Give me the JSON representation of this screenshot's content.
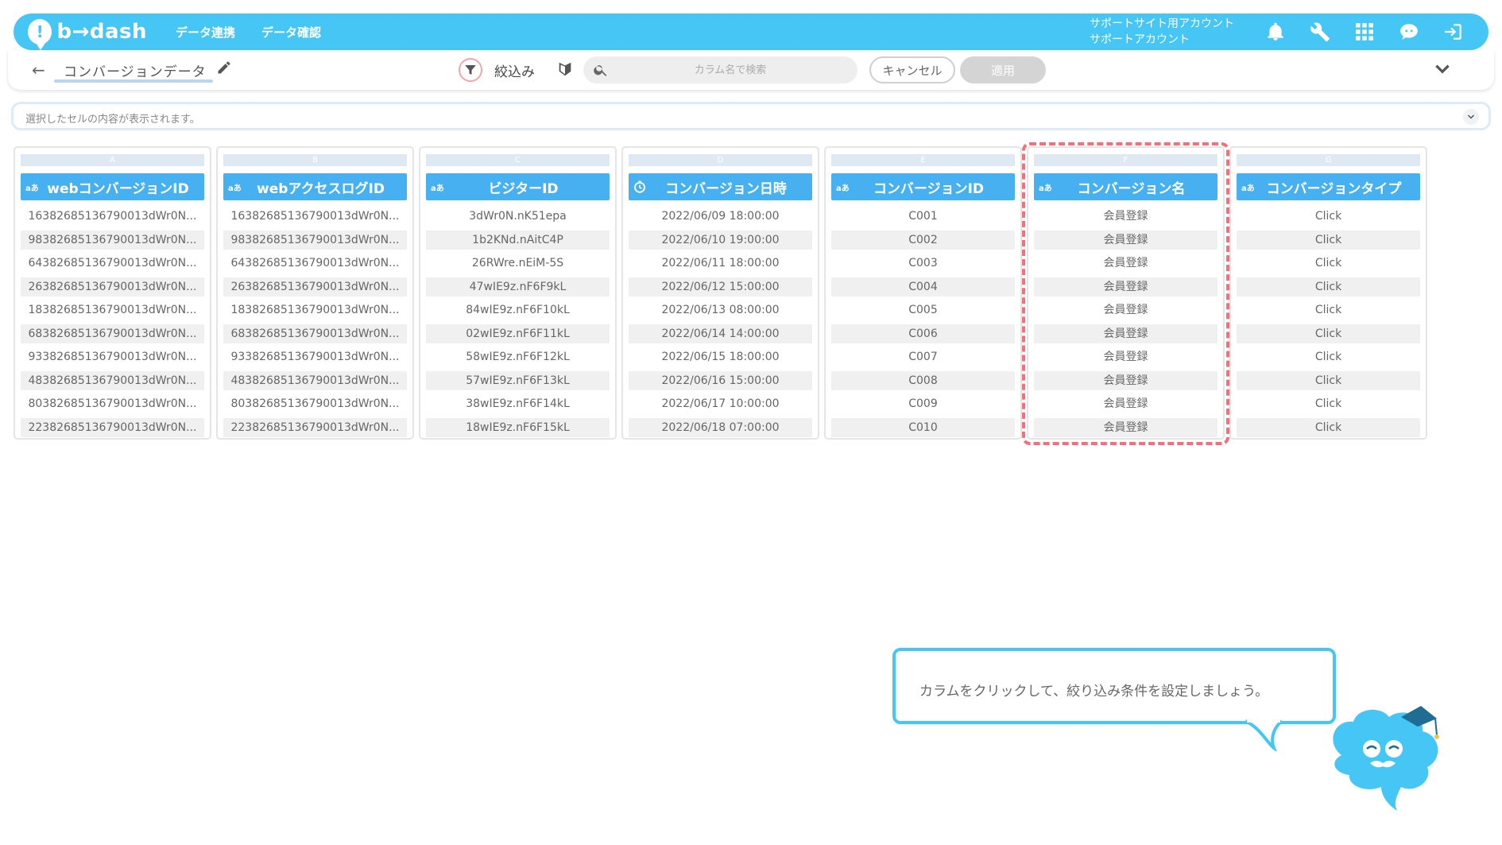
{
  "header": {
    "logo_text": "b→dash",
    "nav": [
      "データ連携",
      "データ確認"
    ],
    "account_line1": "サポートサイト用アカウント",
    "account_line2": "サポートアカウント",
    "icons": [
      "bell-icon",
      "wrench-icon",
      "grid-icon",
      "chat-icon",
      "logout-icon"
    ]
  },
  "subheader": {
    "back_icon": "←",
    "title": "コンバージョンデータ",
    "filter_label": "絞込み",
    "search_placeholder": "カラム名で検索",
    "cancel_label": "キャンセル",
    "apply_label": "適用"
  },
  "cellbar": {
    "placeholder": "選択したセルの内容が表示されます。"
  },
  "columns": [
    {
      "letter": "A",
      "type": "aあ",
      "name": "webコンバージョンID",
      "cells": [
        "16382685136790013dWr0N...",
        "98382685136790013dWr0N...",
        "64382685136790013dWr0N...",
        "26382685136790013dWr0N...",
        "18382685136790013dWr0N...",
        "68382685136790013dWr0N...",
        "93382685136790013dWr0N...",
        "48382685136790013dWr0N...",
        "80382685136790013dWr0N...",
        "22382685136790013dWr0N..."
      ]
    },
    {
      "letter": "B",
      "type": "aあ",
      "name": "webアクセスログID",
      "cells": [
        "16382685136790013dWr0N...",
        "98382685136790013dWr0N...",
        "64382685136790013dWr0N...",
        "26382685136790013dWr0N...",
        "18382685136790013dWr0N...",
        "68382685136790013dWr0N...",
        "93382685136790013dWr0N...",
        "48382685136790013dWr0N...",
        "80382685136790013dWr0N...",
        "22382685136790013dWr0N..."
      ]
    },
    {
      "letter": "C",
      "type": "aあ",
      "name": "ビジターID",
      "cells": [
        "3dWr0N.nK51epa",
        "1b2KNd.nAitC4P",
        "26RWre.nEiM-5S",
        "47wIE9z.nF6F9kL",
        "84wIE9z.nF6F10kL",
        "02wIE9z.nF6F11kL",
        "58wIE9z.nF6F12kL",
        "57wIE9z.nF6F13kL",
        "38wIE9z.nF6F14kL",
        "18wIE9z.nF6F15kL"
      ]
    },
    {
      "letter": "D",
      "type": "clock",
      "name": "コンバージョン日時",
      "cells": [
        "2022/06/09 18:00:00",
        "2022/06/10 19:00:00",
        "2022/06/11 18:00:00",
        "2022/06/12 15:00:00",
        "2022/06/13 08:00:00",
        "2022/06/14 14:00:00",
        "2022/06/15 18:00:00",
        "2022/06/16 15:00:00",
        "2022/06/17 10:00:00",
        "2022/06/18 07:00:00"
      ]
    },
    {
      "letter": "E",
      "type": "aあ",
      "name": "コンバージョンID",
      "cells": [
        "C001",
        "C002",
        "C003",
        "C004",
        "C005",
        "C006",
        "C007",
        "C008",
        "C009",
        "C010"
      ]
    },
    {
      "letter": "F",
      "type": "aあ",
      "name": "コンバージョン名",
      "cells": [
        "会員登録",
        "会員登録",
        "会員登録",
        "会員登録",
        "会員登録",
        "会員登録",
        "会員登録",
        "会員登録",
        "会員登録",
        "会員登録"
      ]
    },
    {
      "letter": "G",
      "type": "aあ",
      "name": "コンバージョンタイプ",
      "cells": [
        "Click",
        "Click",
        "Click",
        "Click",
        "Click",
        "Click",
        "Click",
        "Click",
        "Click",
        "Click"
      ]
    }
  ],
  "tooltip": {
    "text": "カラムをクリックして、絞り込み条件を設定しましょう。"
  },
  "colors": {
    "header_bg": "#46c6f5",
    "column_head_bg": "#46b0f0",
    "highlight": "#f0717c"
  }
}
